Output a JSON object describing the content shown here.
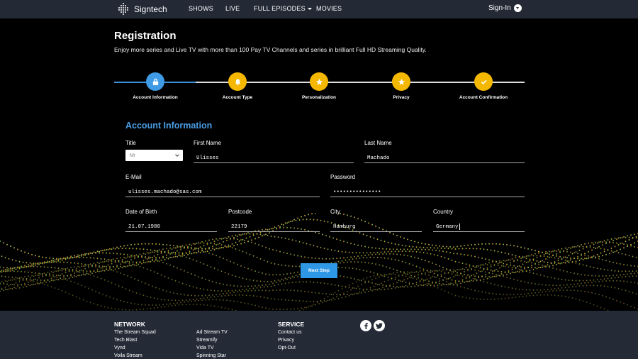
{
  "brand": {
    "name": "Signtech"
  },
  "nav": {
    "items": [
      {
        "label": "SHOWS"
      },
      {
        "label": "LIVE"
      },
      {
        "label": "FULL EPISODES"
      },
      {
        "label": "MOVIES"
      }
    ],
    "signin_label": "Sign-In"
  },
  "hero": {
    "title": "Registration",
    "subtitle": "Enjoy more series and Live TV with more than 100 Pay TV Channels and series in brilliant Full HD Streaming Quality."
  },
  "stepper": {
    "steps": [
      {
        "label": "Account Information",
        "icon": "lock-icon",
        "color": "#3f9be6"
      },
      {
        "label": "Account Type",
        "icon": "bell-icon",
        "color": "#f5b800"
      },
      {
        "label": "Personalization",
        "icon": "star-icon",
        "color": "#f5b800"
      },
      {
        "label": "Privacy",
        "icon": "star-icon",
        "color": "#f5b800"
      },
      {
        "label": "Account Confirmation",
        "icon": "check-icon",
        "color": "#f5b800"
      }
    ]
  },
  "form": {
    "section_title": "Account Information",
    "title": {
      "label": "Title",
      "value": "Mr"
    },
    "first_name": {
      "label": "First Name",
      "value": "Ulisses"
    },
    "last_name": {
      "label": "Last Name",
      "value": "Machado"
    },
    "email": {
      "label": "E-Mail",
      "value": "ulisses.machado@sas.com"
    },
    "password": {
      "label": "Password",
      "value": "•••••••••••••••"
    },
    "dob": {
      "label": "Date of Birth",
      "value": "21.07.1980"
    },
    "postcode": {
      "label": "Postcode",
      "value": "22179"
    },
    "city": {
      "label": "City",
      "value": "Hamburg"
    },
    "country": {
      "label": "Country",
      "value": "Germany"
    },
    "next_label": "Next Step"
  },
  "footer": {
    "network": {
      "heading": "NETWORK",
      "col1": [
        "The Stream Squad",
        "Tech Blast",
        "Vynd",
        "Voila Stream"
      ],
      "col2": [
        "Ad Stream TV",
        "Streamify",
        "Vida TV",
        "Spinning Star"
      ]
    },
    "service": {
      "heading": "SERVICE",
      "links": [
        "Contact us",
        "Privacy",
        "Opt-Out"
      ]
    },
    "social": [
      "facebook-icon",
      "twitter-icon"
    ]
  },
  "colors": {
    "accent": "#2f98e6",
    "step_pending": "#f5b800",
    "nav_bg": "#232a36",
    "footer_bg": "#242b37"
  }
}
